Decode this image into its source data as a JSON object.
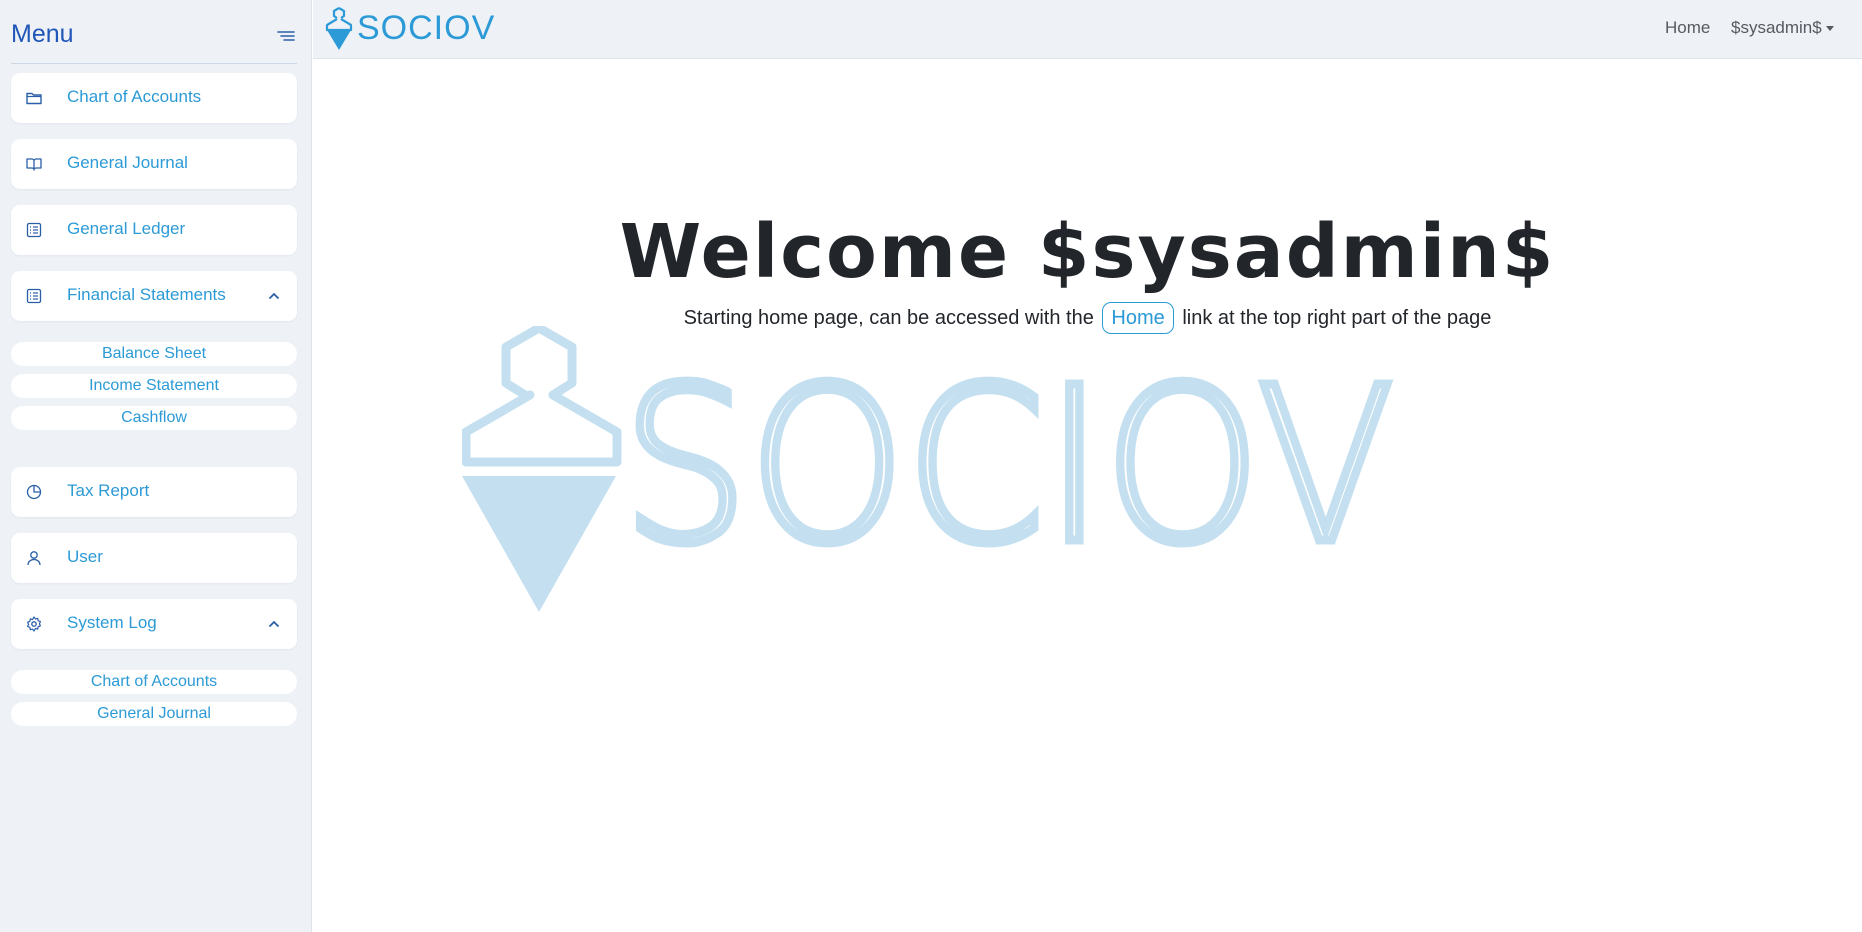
{
  "sidebar": {
    "title": "Menu",
    "items": [
      {
        "label": "Chart of Accounts",
        "icon": "folder-icon"
      },
      {
        "label": "General Journal",
        "icon": "book-icon"
      },
      {
        "label": "General Ledger",
        "icon": "list-icon"
      },
      {
        "label": "Financial Statements",
        "icon": "list-icon",
        "expanded": true,
        "children": [
          "Balance Sheet",
          "Income Statement",
          "Cashflow"
        ]
      },
      {
        "label": "Tax Report",
        "icon": "pie-chart-icon"
      },
      {
        "label": "User",
        "icon": "user-icon"
      },
      {
        "label": "System Log",
        "icon": "gear-icon",
        "expanded": true,
        "children": [
          "Chart of Accounts",
          "General Journal"
        ]
      }
    ]
  },
  "topbar": {
    "brand": "SOCIOV",
    "home_link": "Home",
    "user_menu": "$sysadmin$"
  },
  "main": {
    "heading": "Welcome $sysadmin$",
    "sub_before": "Starting home page, can be accessed with the",
    "sub_link": "Home",
    "sub_after": "link at the top right part of the page",
    "watermark_text": "SOCIOV"
  },
  "colors": {
    "accent": "#2c9ad6",
    "menu_title": "#1f56b8",
    "sidebar_bg": "#eef2f7",
    "watermark": "#c4e0f0",
    "text": "#22262b"
  }
}
